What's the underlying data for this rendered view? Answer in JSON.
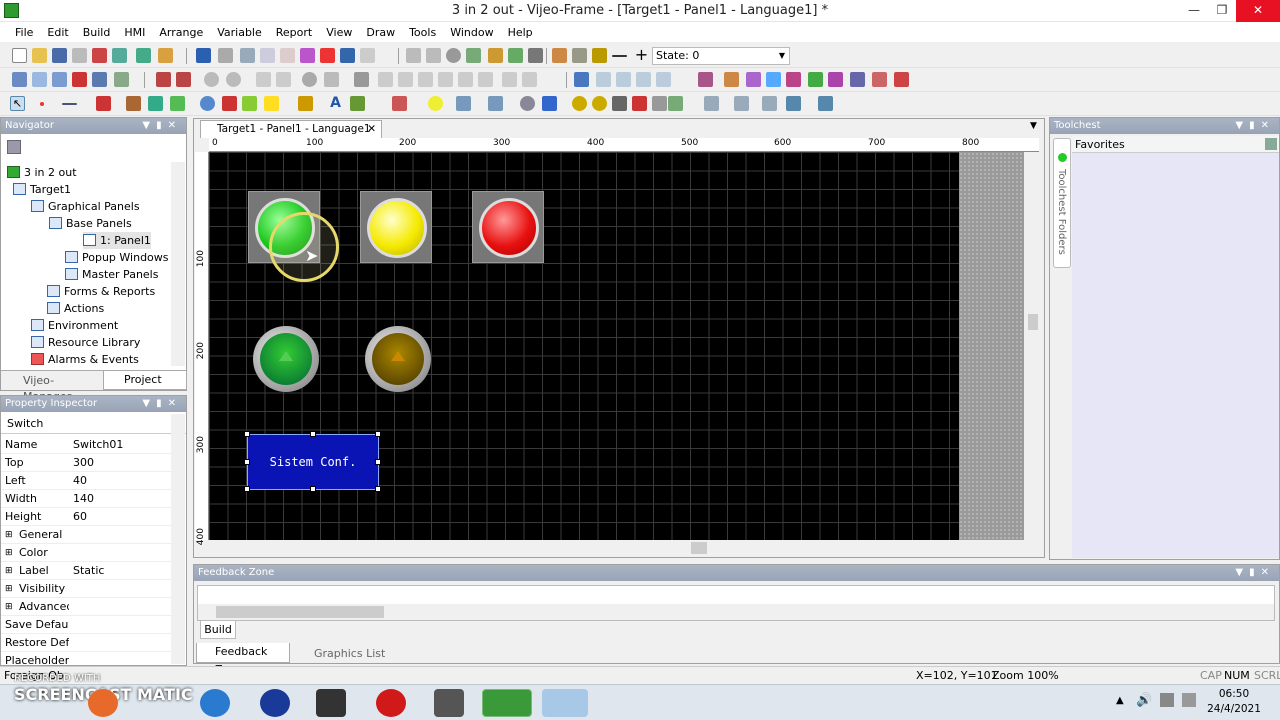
{
  "window": {
    "title": "3 in 2 out - Vijeo-Frame - [Target1 - Panel1 - Language1] *"
  },
  "menu": [
    "File",
    "Edit",
    "Build",
    "HMI",
    "Arrange",
    "Variable",
    "Report",
    "View",
    "Draw",
    "Tools",
    "Window",
    "Help"
  ],
  "toolbar": {
    "state_label": "State: 0"
  },
  "navigator": {
    "title": "Navigator",
    "tree": [
      "3 in 2 out",
      "Target1",
      "Graphical Panels",
      "Base Panels",
      "1: Panel1",
      "Popup Windows",
      "Master Panels",
      "Forms & Reports",
      "Actions",
      "Environment",
      "Resource Library",
      "Alarms & Events"
    ],
    "tabs": [
      "Vijeo-Manager",
      "Project"
    ]
  },
  "inspector": {
    "title": "Property Inspector",
    "object": "Switch",
    "rows": [
      [
        "Name",
        "Switch01"
      ],
      [
        "Top",
        "300"
      ],
      [
        "Left",
        "40"
      ],
      [
        "Width",
        "140"
      ],
      [
        "Height",
        "60"
      ],
      [
        "General",
        ""
      ],
      [
        "Color",
        ""
      ],
      [
        "Label",
        "Static"
      ],
      [
        "Visibility",
        ""
      ],
      [
        "Advanced",
        ""
      ],
      [
        "Save Default",
        ""
      ],
      [
        "Restore Defa",
        ""
      ],
      [
        "Placeholder",
        ""
      ]
    ]
  },
  "editor": {
    "tab": "Target1 - Panel1 - Language1",
    "ruler": [
      "0",
      "100",
      "200",
      "300",
      "400",
      "500",
      "600",
      "700",
      "800"
    ],
    "vruler": [
      "100",
      "200",
      "300",
      "400"
    ],
    "button_label": "Sistem Conf."
  },
  "toolchest": {
    "title": "Toolchest",
    "favorites": "Favorites",
    "folders": "Toolchest Folders"
  },
  "feedback": {
    "title": "Feedback Zone",
    "build_tab": "Build",
    "tabs": [
      "Feedback Zone",
      "Graphics List"
    ]
  },
  "status": {
    "coords": "X=102, Y=101",
    "zoom": "Zoom 100%",
    "cap": "CAP",
    "num": "NUM",
    "scrl": "SCRL",
    "foreign": "Foreign Ob"
  },
  "taskbar": {
    "time": "06:50",
    "date": "24/4/2021",
    "watermark": "RECORDED WITH",
    "brand": "SCREENCAST MATIC"
  },
  "colors": {
    "lamp_green": "#1ec81e",
    "lamp_yellow": "#f5ea00",
    "lamp_red": "#e81010",
    "button_blue": "#0a14b4"
  }
}
